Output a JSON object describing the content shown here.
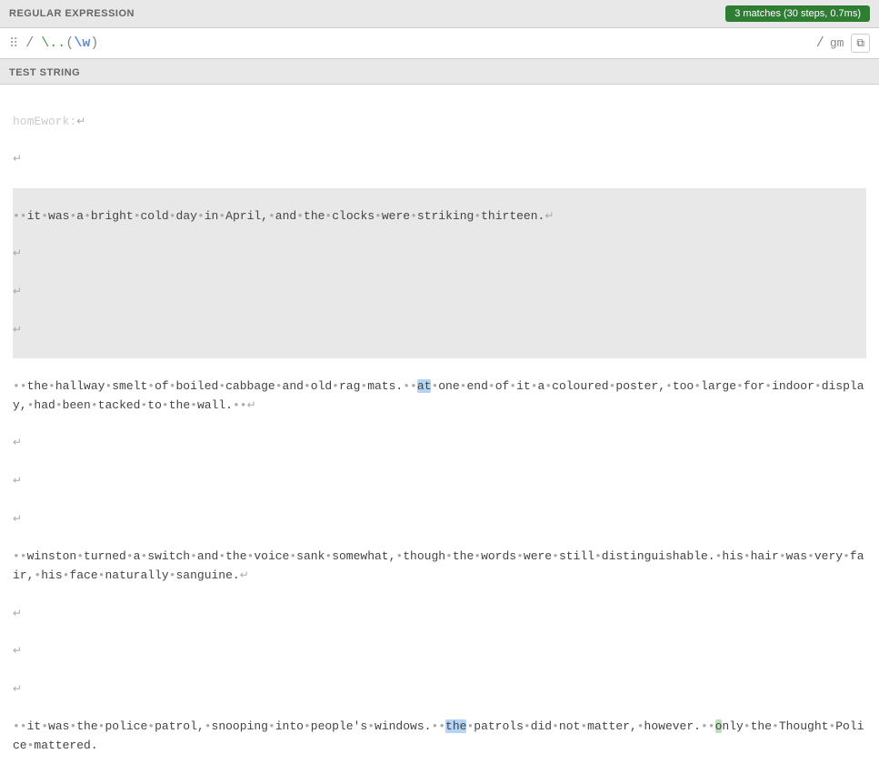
{
  "header": {
    "title": "REGULAR EXPRESSION",
    "match_badge": "3 matches (30 steps, 0.7ms)"
  },
  "regex": {
    "delimiter_open": "/",
    "pattern_parts": [
      {
        "text": "\\.",
        "class": "dot-escape"
      },
      {
        "text": ".",
        "class": "dot"
      },
      {
        "text": "(",
        "class": "paren"
      },
      {
        "text": "\\w",
        "class": "char-class"
      },
      {
        "text": ")",
        "class": "paren"
      }
    ],
    "delimiter_close": "/",
    "flags": "gm",
    "drag_handle": "⠿"
  },
  "test_string_label": "TEST STRING",
  "copy_button_label": "⧉",
  "lines": [
    {
      "text": "homEwork:↵",
      "type": "normal"
    },
    {
      "text": "↵",
      "type": "normal"
    },
    {
      "text": "••it•was•a•bright•cold•day•in•April,•and•the•clocks•were•striking•thirteen.↵",
      "type": "shaded"
    },
    {
      "text": "↵",
      "type": "shaded"
    },
    {
      "text": "↵",
      "type": "shaded"
    },
    {
      "text": "↵",
      "type": "shaded"
    },
    {
      "text": "••the•hallway•smelt•of•boiled•cabbage•and•old•rag•mats.•• at•one•end•of•it•a•coloured•poster,•too•large•for•indoor•display,•had•been•tacked•to•the•wall.••↵",
      "type": "normal",
      "highlights": [
        {
          "word": "at",
          "class": "blue"
        }
      ]
    },
    {
      "text": "↵",
      "type": "normal"
    },
    {
      "text": "↵",
      "type": "normal"
    },
    {
      "text": "↵",
      "type": "normal"
    },
    {
      "text": "••winston•turned•a•switch•and•the•voice•sank•somewhat,•though•the•words•were•still•distinguishable.•his•hair•was•very•fair,•his•face•naturally•sanguine.↵",
      "type": "normal"
    },
    {
      "text": "↵",
      "type": "normal"
    },
    {
      "text": "↵",
      "type": "normal"
    },
    {
      "text": "↵",
      "type": "normal"
    },
    {
      "text": "••it•was•the•police•patrol,•snooping•into•people's•windows.•• the•patrols•did•not•matter,•however.••o only•the•Thought•Police•mattered.",
      "type": "normal",
      "highlights": [
        {
          "word": "the",
          "class": "blue"
        },
        {
          "word": "o",
          "class": "green"
        }
      ]
    }
  ]
}
